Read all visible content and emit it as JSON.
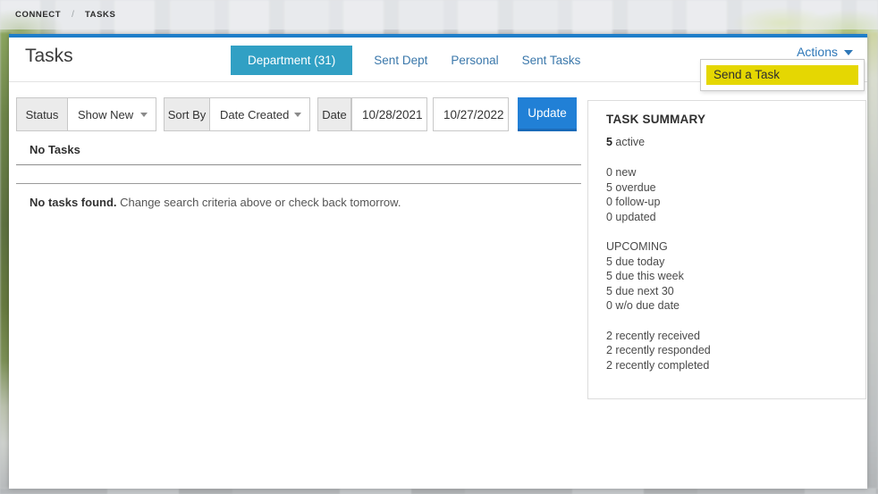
{
  "topbar": {
    "items": [
      {
        "label": "CONNECT"
      },
      {
        "label": "TASKS"
      }
    ],
    "separator": "/"
  },
  "header": {
    "title": "Tasks",
    "actions_label": "Actions"
  },
  "tabs": [
    {
      "label": "Department (31)",
      "active": true
    },
    {
      "label": "Sent Dept",
      "active": false
    },
    {
      "label": "Personal",
      "active": false
    },
    {
      "label": "Sent Tasks",
      "active": false
    }
  ],
  "actions_menu": {
    "items": [
      {
        "label": "Send a Task",
        "highlighted": true
      }
    ]
  },
  "filters": {
    "status_label": "Status",
    "status_value": "Show New",
    "sort_label": "Sort By",
    "sort_value": "Date Created",
    "date_label": "Date",
    "date_from": "10/28/2021",
    "date_to": "10/27/2022",
    "update_label": "Update"
  },
  "results": {
    "header": "No Tasks",
    "empty_bold": "No tasks found.",
    "empty_text": " Change search criteria above or check back tomorrow."
  },
  "summary": {
    "title": "TASK SUMMARY",
    "active_count": "5",
    "active_label": " active",
    "stats1": [
      "0 new",
      "5 overdue",
      "0 follow-up",
      "0 updated"
    ],
    "upcoming_header": "UPCOMING",
    "upcoming": [
      "5 due today",
      "5 due this week",
      "5 due next 30",
      "0 w/o due date"
    ],
    "recent": [
      "2 recently received",
      "2 recently responded",
      "2 recently completed"
    ]
  },
  "colors": {
    "panel_top_border": "#1e7ec9",
    "active_tab": "#31a0c4",
    "update_button": "#2180d6",
    "link_blue": "#3b78ab",
    "actions_blue": "#2f78b8",
    "menu_highlight_yellow": "#e5d702"
  }
}
